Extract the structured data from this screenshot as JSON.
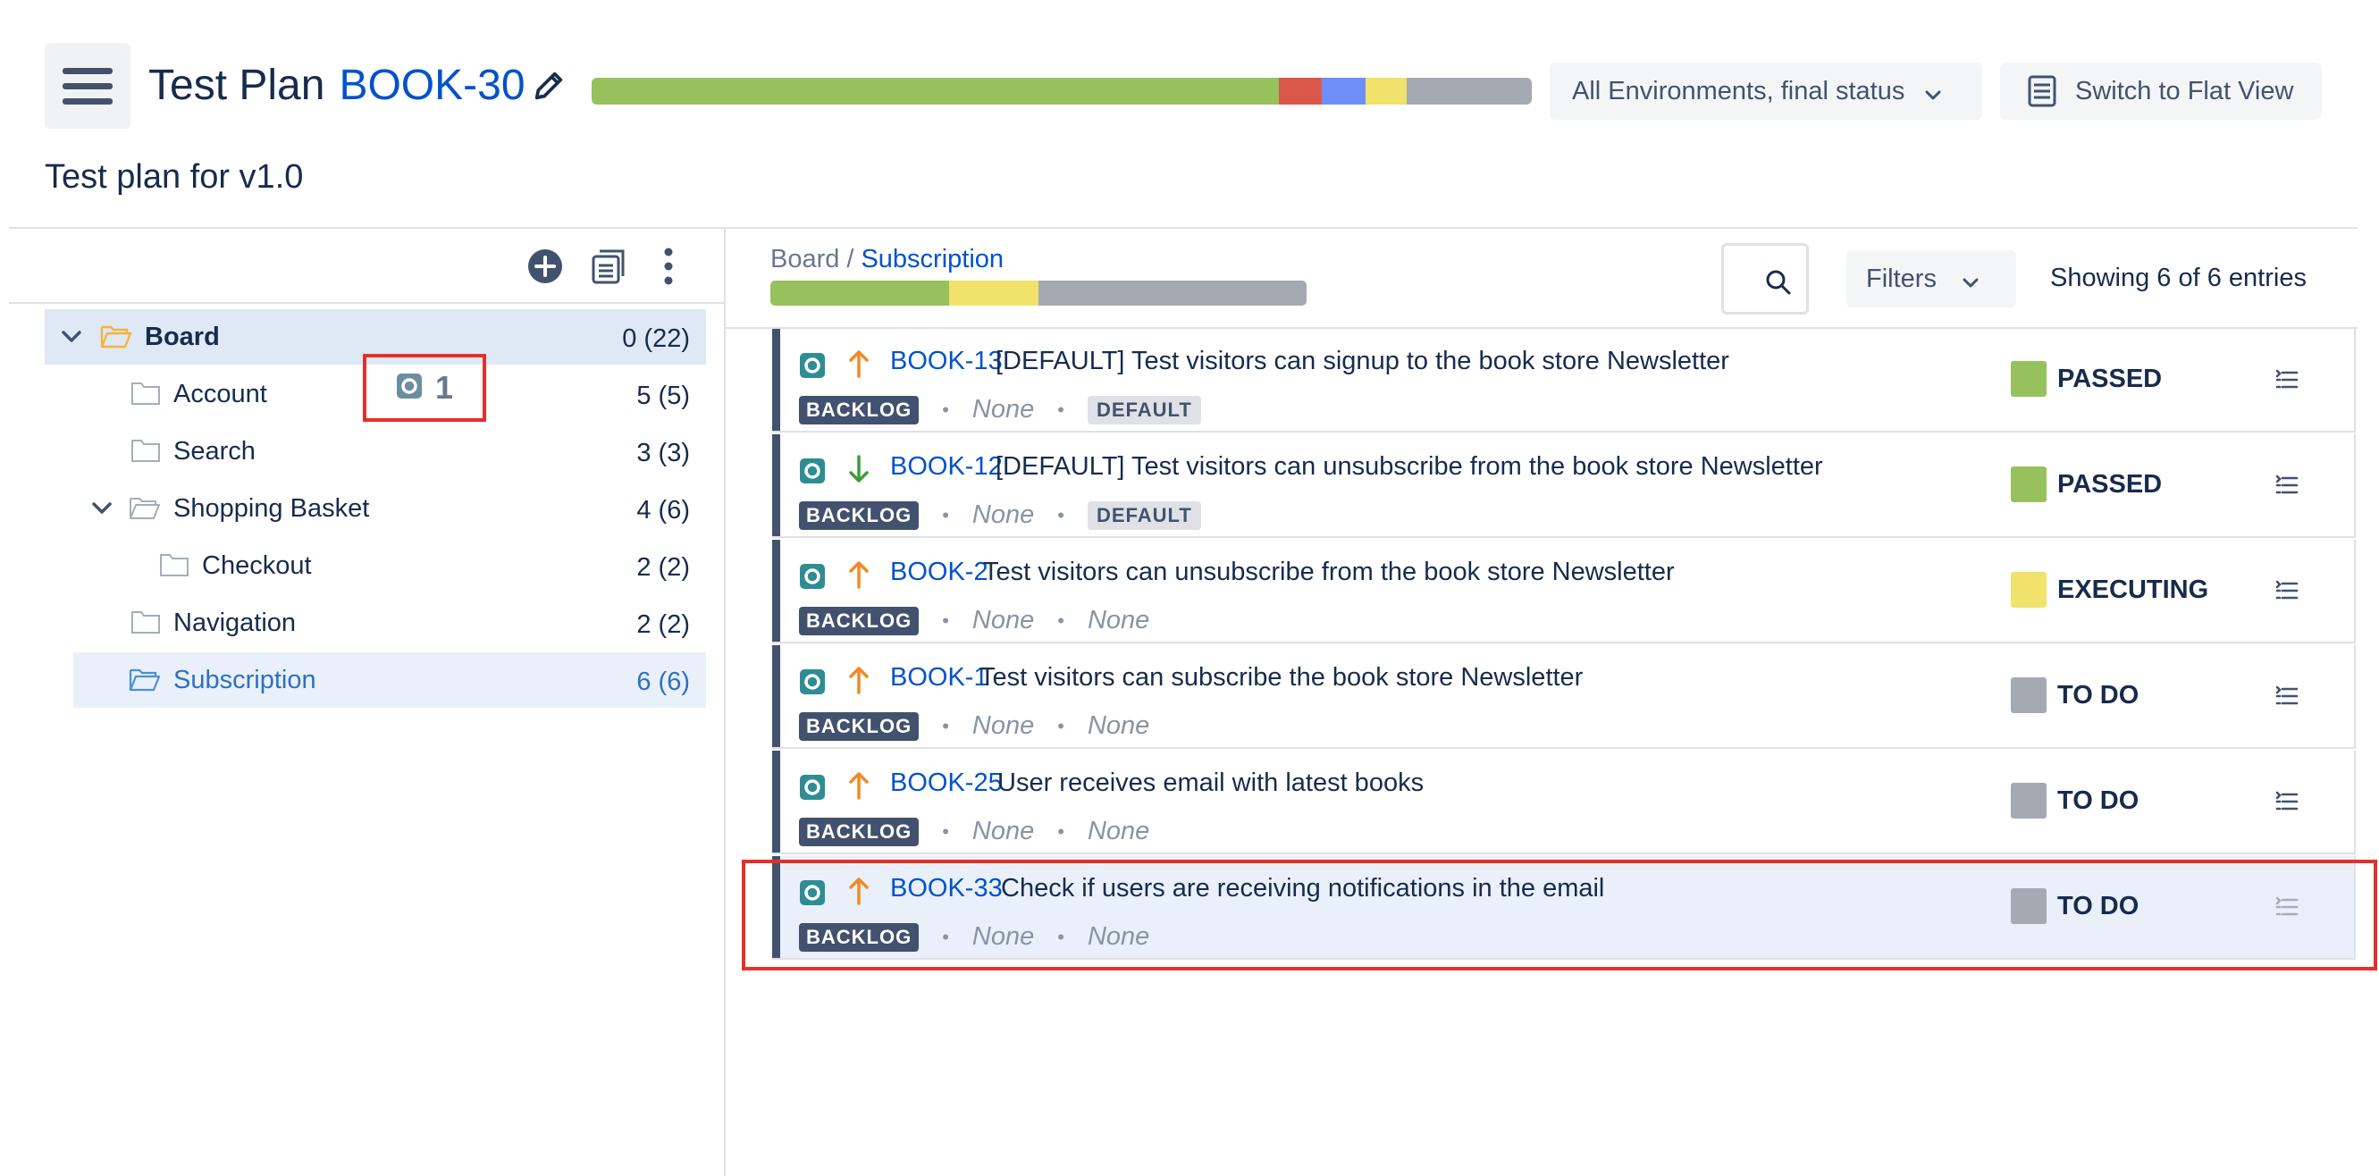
{
  "header": {
    "title_label": "Test Plan",
    "title_key": "BOOK-30",
    "description": "Test plan for v1.0",
    "env_filter": "All Environments, final status",
    "flat_view_label": "Switch to Flat View"
  },
  "colors": {
    "passed": "#97c15c",
    "failed": "#d9584a",
    "executing": "#f0e26b",
    "todo": "#a5a9b2",
    "blue": "#6f8ef6",
    "link": "#0052cc"
  },
  "progress": {
    "main": [
      {
        "status": "passed",
        "fraction": 0.731
      },
      {
        "status": "failed",
        "fraction": 0.046
      },
      {
        "status": "blue",
        "fraction": 0.046
      },
      {
        "status": "executing",
        "fraction": 0.044
      },
      {
        "status": "todo",
        "fraction": 0.133
      }
    ],
    "subscription": [
      {
        "status": "passed",
        "fraction": 0.333
      },
      {
        "status": "executing",
        "fraction": 0.167
      },
      {
        "status": "todo",
        "fraction": 0.5
      }
    ]
  },
  "tree": {
    "items": [
      {
        "label": "Board",
        "count": "0 (22)"
      },
      {
        "label": "Account",
        "count": "5 (5)"
      },
      {
        "label": "Search",
        "count": "3 (3)"
      },
      {
        "label": "Shopping Basket",
        "count": "4 (6)"
      },
      {
        "label": "Checkout",
        "count": "2 (2)"
      },
      {
        "label": "Navigation",
        "count": "2 (2)"
      },
      {
        "label": "Subscription",
        "count": "6 (6)"
      }
    ],
    "drag_count": "1"
  },
  "list": {
    "breadcrumb_root": "Board",
    "breadcrumb_sep": "/",
    "breadcrumb_current": "Subscription",
    "filters_label": "Filters",
    "showing_text": "Showing 6 of 6 entries",
    "rows": [
      {
        "key": "BOOK-13",
        "summary": "[DEFAULT] Test visitors can signup to the book store Newsletter",
        "priority": "up",
        "tag": "BACKLOG",
        "field1": "None",
        "field2": "DEFAULT",
        "status": "PASSED"
      },
      {
        "key": "BOOK-12",
        "summary": "[DEFAULT] Test visitors can unsubscribe from the book store Newsletter",
        "priority": "down",
        "tag": "BACKLOG",
        "field1": "None",
        "field2": "DEFAULT",
        "status": "PASSED"
      },
      {
        "key": "BOOK-2",
        "summary": "Test visitors can unsubscribe from the book store Newsletter",
        "priority": "up",
        "tag": "BACKLOG",
        "field1": "None",
        "field2": "None",
        "status": "EXECUTING"
      },
      {
        "key": "BOOK-1",
        "summary": "Test visitors can subscribe the book store Newsletter",
        "priority": "up",
        "tag": "BACKLOG",
        "field1": "None",
        "field2": "None",
        "status": "TO DO"
      },
      {
        "key": "BOOK-25",
        "summary": "User receives email with latest books",
        "priority": "up",
        "tag": "BACKLOG",
        "field1": "None",
        "field2": "None",
        "status": "TO DO"
      },
      {
        "key": "BOOK-33",
        "summary": "Check if users are receiving notifications in the email",
        "priority": "up",
        "tag": "BACKLOG",
        "field1": "None",
        "field2": "None",
        "status": "TO DO"
      }
    ]
  }
}
